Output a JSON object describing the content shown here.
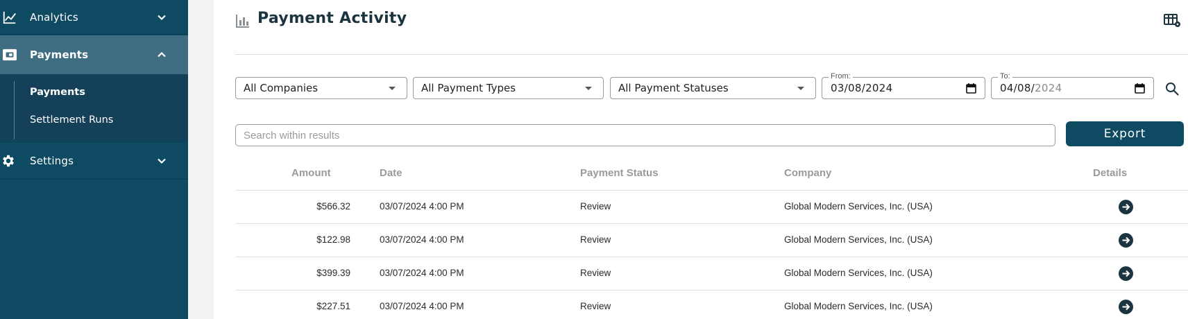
{
  "sidebar": {
    "analytics": {
      "label": "Analytics",
      "icon": "line-chart-icon"
    },
    "payments": {
      "label": "Payments",
      "icon": "wallet-icon"
    },
    "payments_sub": [
      {
        "label": "Payments",
        "active": true
      },
      {
        "label": "Settlement Runs",
        "active": false
      }
    ],
    "settings": {
      "label": "Settings",
      "icon": "gear-icon"
    }
  },
  "header": {
    "title": "Payment Activity",
    "title_icon": "bar-chart-icon",
    "table_settings_icon": "table-settings-icon"
  },
  "filters": {
    "company": "All Companies",
    "payment_type": "All Payment Types",
    "payment_status": "All Payment Statuses",
    "from_label": "From:",
    "from_value": "03/08/2024",
    "to_label": "To:",
    "to_value_month_day": "04/08/",
    "to_value_year": "2024"
  },
  "search": {
    "placeholder": "Search within results"
  },
  "export_label": "Export",
  "table": {
    "headers": {
      "amount": "Amount",
      "date": "Date",
      "status": "Payment Status",
      "company": "Company",
      "details": "Details"
    },
    "rows": [
      {
        "amount": "$566.32",
        "date": "03/07/2024 4:00 PM",
        "status": "Review",
        "company": "Global Modern Services, Inc. (USA)"
      },
      {
        "amount": "$122.98",
        "date": "03/07/2024 4:00 PM",
        "status": "Review",
        "company": "Global Modern Services, Inc. (USA)"
      },
      {
        "amount": "$399.39",
        "date": "03/07/2024 4:00 PM",
        "status": "Review",
        "company": "Global Modern Services, Inc. (USA)"
      },
      {
        "amount": "$227.51",
        "date": "03/07/2024 4:00 PM",
        "status": "Review",
        "company": "Global Modern Services, Inc. (USA)"
      }
    ]
  },
  "colors": {
    "sidebar": "#0f4a63",
    "sidebar_active": "#3f6e82",
    "accent": "#0f4a63",
    "details_icon": "#1c3440"
  }
}
